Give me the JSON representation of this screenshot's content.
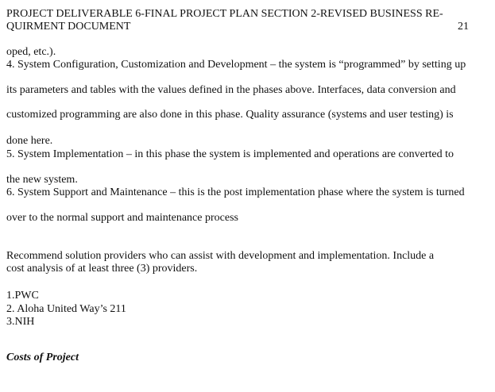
{
  "header": {
    "title": "PROJECT DELIVERABLE 6-FINAL PROJECT PLAN SECTION 2-REVISED BUSINESS RE-QUIRMENT DOCUMENT",
    "page_number": "21"
  },
  "body": {
    "lines": [
      "oped, etc.).",
      "4. System Configuration, Customization and Development – the system is “programmed” by setting up",
      "its parameters and tables with the values defined in the phases above. Interfaces, data conversion and",
      "customized programming are also done in this phase. Quality assurance (systems and user testing) is",
      "done here.",
      "5. System Implementation – in this phase the system is implemented and operations are converted to",
      "the new system.",
      "6. System Support and Maintenance – this is the post implementation phase where the system is turned",
      "over to the normal support and maintenance process"
    ],
    "recommend_lines": [
      "Recommend solution providers who can assist with development and implementation. Include a",
      "cost analysis of at least three (3) providers."
    ],
    "providers": [
      "1.PWC",
      "2. Aloha United Way’s 211",
      "3.NIH"
    ],
    "costs_heading": "Costs of Project"
  }
}
